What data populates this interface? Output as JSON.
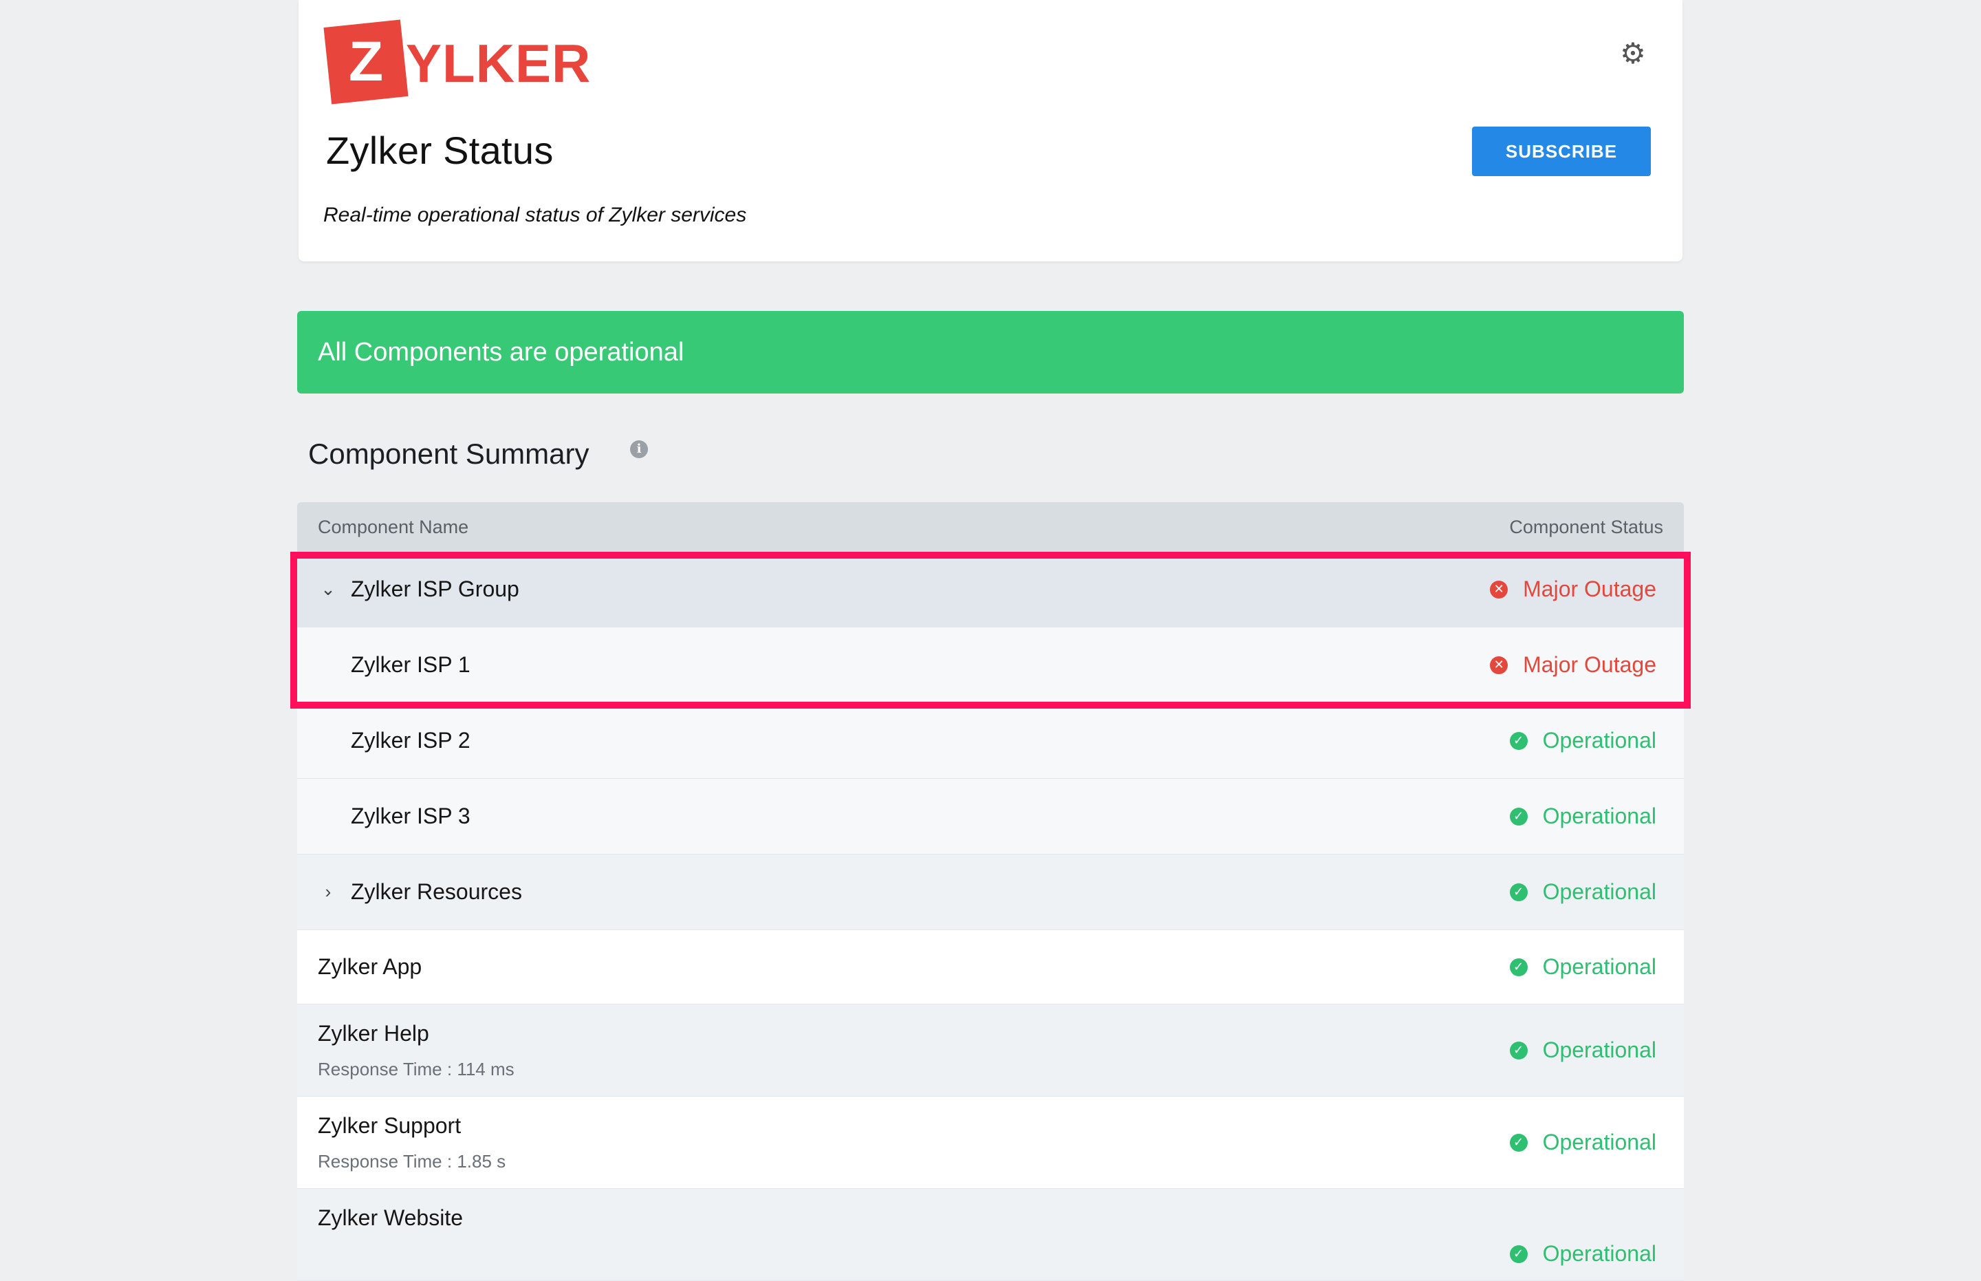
{
  "header": {
    "logo_letter": "Z",
    "logo_rest": "YLKER",
    "title": "Zylker Status",
    "subscribe_label": "SUBSCRIBE",
    "tagline": "Real-time operational status of Zylker services",
    "settings_icon": "gear-icon"
  },
  "banner": {
    "text": "All Components are operational",
    "color": "#37c976"
  },
  "summary": {
    "title": "Component Summary",
    "info_icon": "info-icon",
    "columns": [
      "Component Name",
      "Component Status"
    ],
    "rows": [
      {
        "name": "Zylker ISP Group",
        "status": "Major Outage",
        "state": "outage",
        "expand": "chevron-down-icon"
      },
      {
        "name": "Zylker ISP 1",
        "status": "Major Outage",
        "state": "outage"
      },
      {
        "name": "Zylker ISP 2",
        "status": "Operational",
        "state": "ok"
      },
      {
        "name": "Zylker ISP 3",
        "status": "Operational",
        "state": "ok"
      },
      {
        "name": "Zylker Resources",
        "status": "Operational",
        "state": "ok",
        "expand": "chevron-right-icon"
      },
      {
        "name": "Zylker App",
        "status": "Operational",
        "state": "ok"
      },
      {
        "name": "Zylker Help",
        "response": "Response Time : 114 ms",
        "status": "Operational",
        "state": "ok"
      },
      {
        "name": "Zylker Support",
        "response": "Response Time : 1.85 s",
        "status": "Operational",
        "state": "ok"
      },
      {
        "name": "Zylker Website",
        "status": "Operational",
        "state": "ok"
      }
    ]
  },
  "colors": {
    "outage": "#e4473b",
    "operational": "#2fbf71",
    "accent": "#2488e6",
    "highlight": "#ff0f5b"
  }
}
